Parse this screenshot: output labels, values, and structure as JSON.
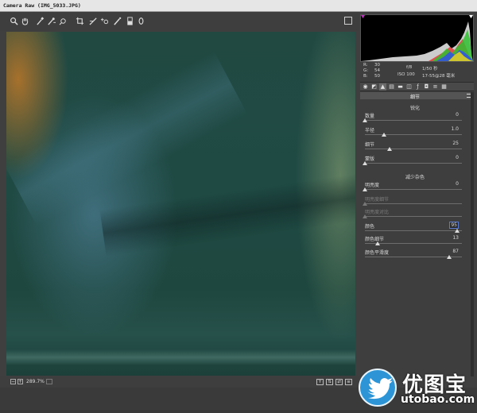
{
  "window": {
    "title": "Camera Raw (IMG_5033.JPG)"
  },
  "toolbar": {
    "tools": [
      {
        "icon": "zoom-icon",
        "glyph": "🔍"
      },
      {
        "icon": "hand-icon",
        "glyph": "✋"
      },
      {
        "icon": "white-balance-icon",
        "glyph": "⁄"
      },
      {
        "icon": "color-sampler-icon",
        "glyph": "⁄"
      },
      {
        "icon": "targeted-adjustment-icon",
        "glyph": "◎"
      },
      {
        "icon": "crop-icon",
        "glyph": "⌗"
      },
      {
        "icon": "straighten-icon",
        "glyph": "⁄"
      },
      {
        "icon": "red-eye-icon",
        "glyph": "+o"
      },
      {
        "icon": "adjustment-brush-icon",
        "glyph": "⁄"
      },
      {
        "icon": "graduated-filter-icon",
        "glyph": "▮"
      },
      {
        "icon": "radial-filter-icon",
        "glyph": "0"
      }
    ]
  },
  "readout": {
    "r_label": "R:",
    "r_value": "30",
    "g_label": "G:",
    "g_value": "54",
    "b_label": "B:",
    "b_value": "50",
    "aperture": "f/8",
    "shutter": "1/50 秒",
    "iso": "ISO 100",
    "lens": "17-55@28 毫米"
  },
  "panel": {
    "title": "细节",
    "sharpening": {
      "heading": "锐化",
      "amount": {
        "label": "数量",
        "value": "0",
        "level": 0.0
      },
      "radius": {
        "label": "半径",
        "value": "1.0",
        "level": 0.2
      },
      "detail": {
        "label": "细节",
        "value": "25",
        "level": 0.25
      },
      "masking": {
        "label": "蒙版",
        "value": "0",
        "level": 0.0
      }
    },
    "noise_reduction": {
      "heading": "减少杂色",
      "luminance": {
        "label": "明亮度",
        "value": "0",
        "level": 0.0
      },
      "luminance_detail": {
        "label": "明亮度细节",
        "value": "",
        "level": 0.0
      },
      "luminance_contrast": {
        "label": "明亮度对比",
        "value": "",
        "level": 0.0
      },
      "color": {
        "label": "颜色",
        "value": "95",
        "level": 0.95
      },
      "color_detail": {
        "label": "颜色细节",
        "value": "13",
        "level": 0.13
      },
      "color_smoothness": {
        "label": "颜色平滑度",
        "value": "87",
        "level": 0.87
      }
    }
  },
  "status": {
    "zoom": "289.7%"
  },
  "watermark": {
    "text": "优图宝",
    "url": "utobao.com"
  },
  "colors": {
    "watermark_blue": "#2d95d6",
    "panel_bg": "#3e3e3e",
    "titlebar_bg": "#e6e6e6"
  }
}
